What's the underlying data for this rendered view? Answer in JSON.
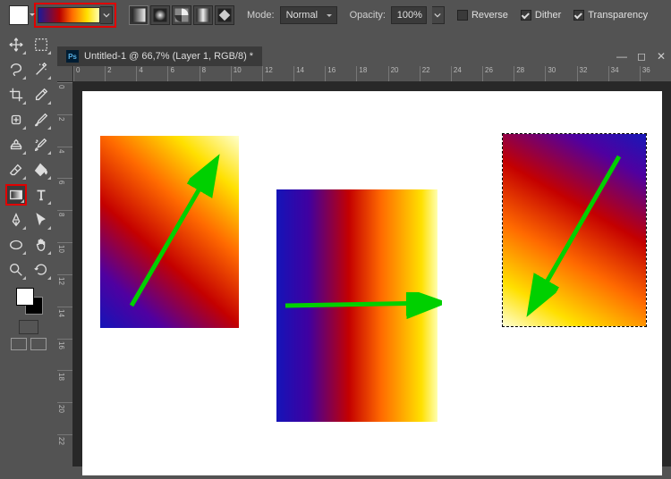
{
  "options": {
    "mode_label": "Mode:",
    "mode_value": "Normal",
    "opacity_label": "Opacity:",
    "opacity_value": "100%",
    "reverse_label": "Reverse",
    "reverse_checked": false,
    "dither_label": "Dither",
    "dither_checked": true,
    "transparency_label": "Transparency",
    "transparency_checked": true,
    "gradient_types": [
      "linear",
      "radial",
      "angle",
      "reflected",
      "diamond"
    ],
    "gradient_type_selected": 0
  },
  "toolbox": {
    "tools": [
      "move",
      "rect-marquee",
      "lasso",
      "magic-wand",
      "crop",
      "eyedropper",
      "healing-brush",
      "brush",
      "clone-stamp",
      "history-brush",
      "eraser",
      "paint-bucket",
      "gradient",
      "type",
      "pen",
      "direct-select",
      "ellipse",
      "hand",
      "zoom",
      "rotate-view"
    ],
    "highlighted_tool": "gradient"
  },
  "document": {
    "ps_badge": "Ps",
    "title": "Untitled-1 @ 66,7% (Layer 1, RGB/8) *",
    "ruler_h": [
      "0",
      "2",
      "4",
      "6",
      "8",
      "10",
      "12",
      "14",
      "16",
      "18",
      "20",
      "22",
      "24",
      "26",
      "28",
      "30",
      "32",
      "34",
      "36"
    ],
    "ruler_v": [
      "0",
      "2",
      "4",
      "6",
      "8",
      "10",
      "12",
      "14",
      "16",
      "18",
      "20",
      "22"
    ]
  },
  "gradient_examples": [
    {
      "name": "diagonal-upright",
      "arrow": "diag-up"
    },
    {
      "name": "horizontal",
      "arrow": "right"
    },
    {
      "name": "diagonal-downleft-selected",
      "arrow": "diag-down"
    }
  ]
}
